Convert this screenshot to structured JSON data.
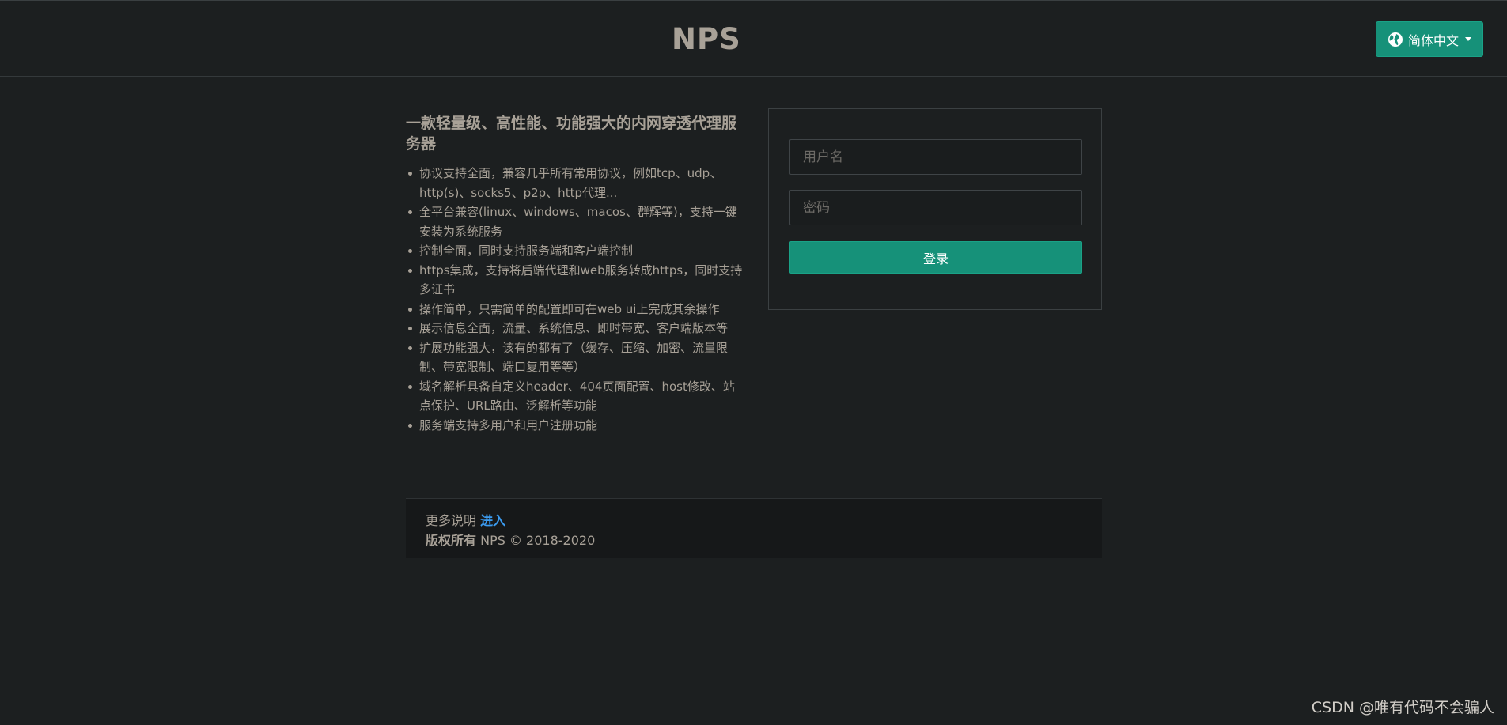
{
  "header": {
    "brand": "NPS",
    "language_button": "简体中文",
    "globe_icon": "globe-icon"
  },
  "intro": {
    "title": "一款轻量级、高性能、功能强大的内网穿透代理服务器",
    "features": [
      "协议支持全面，兼容几乎所有常用协议，例如tcp、udp、http(s)、socks5、p2p、http代理...",
      "全平台兼容(linux、windows、macos、群辉等)，支持一键安装为系统服务",
      "控制全面，同时支持服务端和客户端控制",
      "https集成，支持将后端代理和web服务转成https，同时支持多证书",
      "操作简单，只需简单的配置即可在web ui上完成其余操作",
      "展示信息全面，流量、系统信息、即时带宽、客户端版本等",
      "扩展功能强大，该有的都有了（缓存、压缩、加密、流量限制、带宽限制、端口复用等等）",
      "域名解析具备自定义header、404页面配置、host修改、站点保护、URL路由、泛解析等功能",
      "服务端支持多用户和用户注册功能"
    ]
  },
  "login": {
    "username_placeholder": "用户名",
    "password_placeholder": "密码",
    "submit_label": "登录"
  },
  "footer": {
    "more_text": "更多说明",
    "more_link": "进入",
    "copyright_label": "版权所有",
    "copyright_text": "NPS © 2018-2020"
  },
  "watermark": "CSDN @唯有代码不会骗人",
  "colors": {
    "background": "#1c1f20",
    "accent": "#169179",
    "link": "#3b9bf0",
    "text": "#a8a197"
  }
}
